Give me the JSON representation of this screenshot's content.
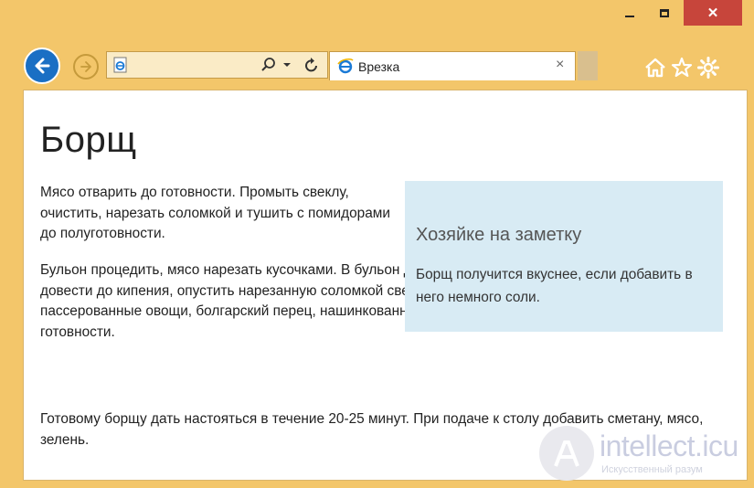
{
  "window": {
    "minimize_label": "—",
    "maximize_label": "□",
    "close_label": "✕"
  },
  "toolbar": {
    "back_icon": "back-arrow-icon",
    "forward_icon": "forward-arrow-icon",
    "home_icon": "home-icon",
    "favorites_icon": "star-icon",
    "settings_icon": "gear-icon"
  },
  "tab": {
    "title": "Врезка",
    "close_label": "×"
  },
  "page": {
    "heading": "Борщ",
    "p1": "Мясо отварить до готовности. Промыть свеклу, очистить, нарезать соломкой и тушить с помидорами до полуготовности.",
    "p2": "Бульон процедить, мясо нарезать кусочками. В бульон добавить нарезанный дольками картофель, довести до кипения, опустить нарезанную соломкой свежую капусту и варить 10-15 минут, добавить пассерованные овощи, болгарский перец, нашинкованный тонкой соломкой, специи и довести до готовности.",
    "p3": "Готовому борщу дать настояться в течение 20-25 минут. При подаче к столу добавить сметану, мясо, зелень.",
    "aside": {
      "title": "Хозяйке на заметку",
      "text": "Борщ получится вкуснее, если добавить в него немного соли."
    }
  },
  "watermark": {
    "name": "intellect.icu",
    "tagline": "Искусственный разум"
  },
  "colors": {
    "frame": "#f3c66a",
    "close": "#c7453b",
    "aside_bg": "#d8ebf4",
    "back_button": "#1a6fc4"
  }
}
